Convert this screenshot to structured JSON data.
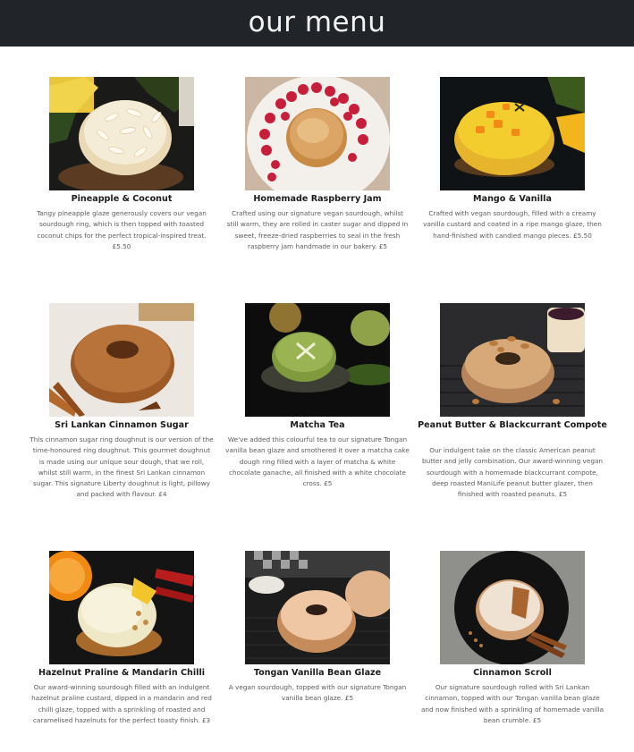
{
  "header": {
    "title": "our menu"
  },
  "items": [
    {
      "name": "Pineapple & Coconut",
      "description": "Tangy pineapple glaze generously covers our vegan sourdough ring, which is then topped with toasted coconut chips for the perfect tropical-inspired treat. £5.50"
    },
    {
      "name": "Homemade Raspberry Jam",
      "description": "Crafted using our signature vegan sourdough, whilst still warm, they are rolled in caster sugar and dipped in sweet, freeze-dried raspberries to seal in the fresh raspberry jam handmade in our bakery. £5"
    },
    {
      "name": "Mango & Vanilla",
      "description": "Crafted with vegan sourdough, filled with a creamy vanilla custard and coated in a ripe mango glaze, then hand-finished with candied mango pieces. £5.50"
    },
    {
      "name": "Sri Lankan Cinnamon Sugar",
      "description": "This cinnamon sugar ring doughnut is our version of the time-honoured ring doughnut. This gourmet doughnut is made using our unique sour dough, that we roll, whilst still warm, in the finest Sri Lankan cinnamon sugar. This signature Liberty doughnut is light, pillowy and packed with flavour. £4"
    },
    {
      "name": "Matcha Tea",
      "description": "We've added this colourful tea to our signature Tongan vanilla bean glaze and smothered it over a matcha cake dough ring filled with a layer of matcha & white chocolate ganache, all finished with a white chocolate cross. £5"
    },
    {
      "name": "Peanut Butter & Blackcurrant Compote",
      "description": "Our indulgent take on the classic American peanut butter and jelly combination. Our award-winning vegan sourdough with a homemade blackcurrant compote, deep roasted ManiLife peanut butter glazer, then finished with roasted peanuts. £5"
    },
    {
      "name": "Hazelnut Praline & Mandarin Chilli",
      "description": "Our award-winning sourdough filled with an indulgent hazelnut praline custard, dipped in a mandarin and red chilli glaze, topped with a sprinkling of roasted and caramelised hazelnuts for the perfect toasty finish. £3"
    },
    {
      "name": "Tongan Vanilla Bean Glaze",
      "description": "A vegan sourdough, topped with our signature Tongan vanilla bean glaze. £5"
    },
    {
      "name": "Cinnamon Scroll",
      "description": "Our signature sourdough rolled with Sri Lankan cinnamon, topped with our Tongan vanilla bean glaze and now finished with a sprinkling of homemade vanilla bean crumble. £5"
    }
  ]
}
